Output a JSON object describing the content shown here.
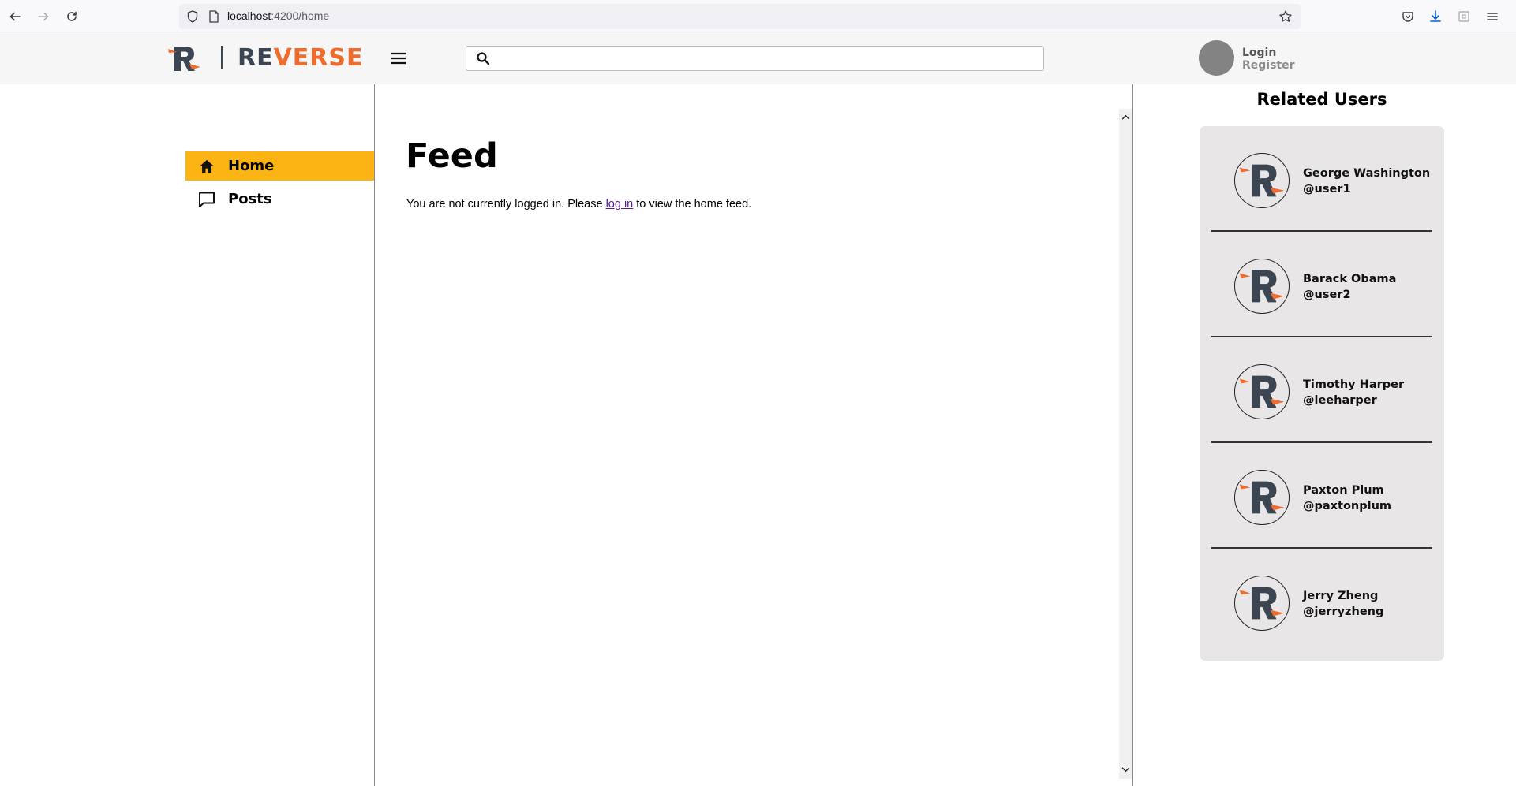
{
  "browser": {
    "url_host": "localhost",
    "url_path": ":4200/home"
  },
  "header": {
    "logo_re": "RE",
    "logo_verse": "VERSE",
    "search_placeholder": "",
    "login": "Login",
    "register": "Register"
  },
  "sidebar": {
    "items": [
      {
        "label": "Home",
        "icon": "home-icon",
        "active": true
      },
      {
        "label": "Posts",
        "icon": "chat-bubble-icon",
        "active": false
      }
    ]
  },
  "feed": {
    "title": "Feed",
    "msg_before": "You are not currently logged in. Please ",
    "msg_link": "log in",
    "msg_after": " to view the home feed."
  },
  "related": {
    "title": "Related Users",
    "users": [
      {
        "name": "George Washington",
        "handle": "@user1"
      },
      {
        "name": "Barack Obama",
        "handle": "@user2"
      },
      {
        "name": "Timothy Harper",
        "handle": "@leeharper"
      },
      {
        "name": "Paxton Plum",
        "handle": "@paxtonplum"
      },
      {
        "name": "Jerry Zheng",
        "handle": "@jerryzheng"
      }
    ]
  },
  "colors": {
    "accent": "#fbb414",
    "brand_orange": "#ef6c2c",
    "brand_dark": "#3b4652"
  }
}
